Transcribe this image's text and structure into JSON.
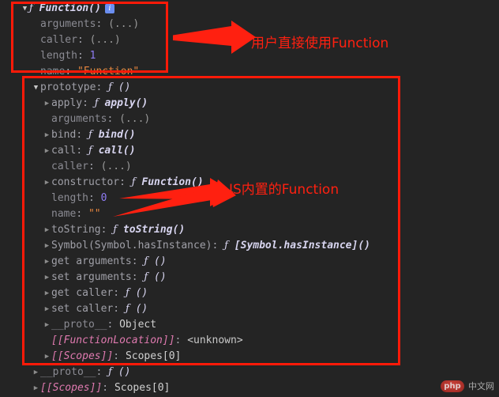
{
  "console": {
    "rows": [
      {
        "indent": 0,
        "arrow": "open",
        "key": "",
        "keyclass": "none",
        "value": "Function()",
        "valclass": "fn-bold",
        "fnmark": true,
        "info": true
      },
      {
        "indent": 1,
        "arrow": "none",
        "key": "arguments",
        "keyclass": "dim",
        "value": "(...)",
        "valclass": "dots"
      },
      {
        "indent": 1,
        "arrow": "none",
        "key": "caller",
        "keyclass": "dim",
        "value": "(...)",
        "valclass": "dots"
      },
      {
        "indent": 1,
        "arrow": "none",
        "key": "length",
        "keyclass": "dim",
        "value": "1",
        "valclass": "num"
      },
      {
        "indent": 1,
        "arrow": "none",
        "key": "name",
        "keyclass": "dim",
        "value": "\"Function\"",
        "valclass": "str"
      },
      {
        "indent": 1,
        "arrow": "open",
        "key": "prototype",
        "keyclass": "key",
        "value": "()",
        "valclass": "fn-plain",
        "fnmark": true
      },
      {
        "indent": 2,
        "arrow": "closed",
        "key": "apply",
        "keyclass": "key",
        "value": "apply()",
        "valclass": "fn-bold",
        "fnmark": true
      },
      {
        "indent": 2,
        "arrow": "none",
        "key": "arguments",
        "keyclass": "dim",
        "value": "(...)",
        "valclass": "dots"
      },
      {
        "indent": 2,
        "arrow": "closed",
        "key": "bind",
        "keyclass": "key",
        "value": "bind()",
        "valclass": "fn-bold",
        "fnmark": true
      },
      {
        "indent": 2,
        "arrow": "closed",
        "key": "call",
        "keyclass": "key",
        "value": "call()",
        "valclass": "fn-bold",
        "fnmark": true
      },
      {
        "indent": 2,
        "arrow": "none",
        "key": "caller",
        "keyclass": "dim",
        "value": "(...)",
        "valclass": "dots"
      },
      {
        "indent": 2,
        "arrow": "closed",
        "key": "constructor",
        "keyclass": "key",
        "value": "Function()",
        "valclass": "fn-bold",
        "fnmark": true
      },
      {
        "indent": 2,
        "arrow": "none",
        "key": "length",
        "keyclass": "dim",
        "value": "0",
        "valclass": "num"
      },
      {
        "indent": 2,
        "arrow": "none",
        "key": "name",
        "keyclass": "dim",
        "value": "\"\"",
        "valclass": "str"
      },
      {
        "indent": 2,
        "arrow": "closed",
        "key": "toString",
        "keyclass": "key",
        "value": "toString()",
        "valclass": "fn-bold",
        "fnmark": true
      },
      {
        "indent": 2,
        "arrow": "closed",
        "key": "Symbol(Symbol.hasInstance)",
        "keyclass": "key",
        "value": "[Symbol.hasInstance]()",
        "valclass": "fn-bold",
        "fnmark": true
      },
      {
        "indent": 2,
        "arrow": "closed",
        "key": "get arguments",
        "keyclass": "key",
        "value": "()",
        "valclass": "fn-plain",
        "fnmark": true
      },
      {
        "indent": 2,
        "arrow": "closed",
        "key": "set arguments",
        "keyclass": "key",
        "value": "()",
        "valclass": "fn-plain",
        "fnmark": true
      },
      {
        "indent": 2,
        "arrow": "closed",
        "key": "get caller",
        "keyclass": "key",
        "value": "()",
        "valclass": "fn-plain",
        "fnmark": true
      },
      {
        "indent": 2,
        "arrow": "closed",
        "key": "set caller",
        "keyclass": "key",
        "value": "()",
        "valclass": "fn-plain",
        "fnmark": true
      },
      {
        "indent": 2,
        "arrow": "closed",
        "key": "__proto__",
        "keyclass": "dim",
        "value": "Object",
        "valclass": "obj"
      },
      {
        "indent": 2,
        "arrow": "none",
        "key": "[[FunctionLocation]]",
        "keyclass": "slot",
        "value": "<unknown>",
        "valclass": "unknown"
      },
      {
        "indent": 2,
        "arrow": "closed",
        "key": "[[Scopes]]",
        "keyclass": "slot",
        "value": "Scopes[0]",
        "valclass": "scopes"
      },
      {
        "indent": 1,
        "arrow": "closed",
        "key": "__proto__",
        "keyclass": "dim",
        "value": "()",
        "valclass": "fn-plain",
        "fnmark": true
      },
      {
        "indent": 1,
        "arrow": "closed",
        "key": "[[Scopes]]",
        "keyclass": "slot",
        "value": "Scopes[0]",
        "valclass": "scopes"
      }
    ],
    "info_badge_label": "i",
    "triangle_open": "▼",
    "triangle_closed": "▶",
    "function_mark": "ƒ"
  },
  "annotations": {
    "user": "用户直接使用Function",
    "native": "JS内置的Function",
    "box_user_name": "user-direct-function-box",
    "box_native_name": "js-builtin-function-box"
  },
  "watermark": {
    "badge": "php",
    "text": "中文网"
  },
  "colors": {
    "background": "#242424",
    "annotation_red": "#ff2010",
    "box_red": "#ff1a08",
    "property_name": "#a0a0a8",
    "number": "#8f7cf5",
    "string": "#e8863f",
    "internal_slot": "#e07ab0",
    "info_badge": "#6a8ef0"
  }
}
